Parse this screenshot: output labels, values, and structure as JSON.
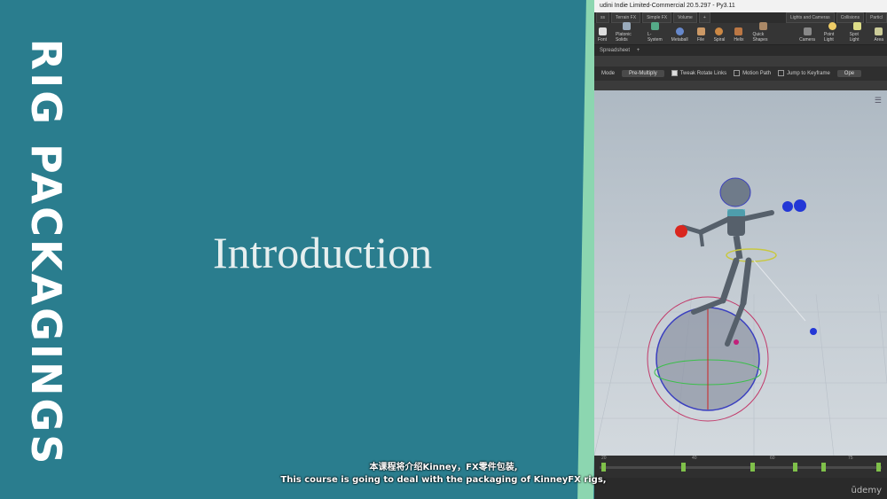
{
  "slide": {
    "vertical_title": "RIG PACKAGINGS",
    "heading": "Introduction",
    "bg_color": "#2a7d8e",
    "divider_color": "#8cd6b0"
  },
  "app": {
    "title": "udini Indie Limited-Commercial 20.5.297 - Py3.11",
    "shelf_tabs": [
      "ss",
      "Terrain FX",
      "Simple FX",
      "Volume",
      "+"
    ],
    "shelf_tabs_right": [
      "Lights and Cameras",
      "Collisions",
      "Particl"
    ],
    "tools": [
      "Font",
      "Platonic Solids",
      "L-System",
      "Metaball",
      "File",
      "Spiral",
      "Helix",
      "Quick Shapes"
    ],
    "tools_right": [
      "Camera",
      "Point Light",
      "Spot Light",
      "Area"
    ],
    "spreadsheet_tab": "Spreadsheet",
    "toolbar": {
      "mode_label": "Mode",
      "mode_value": "Pre-Multiply",
      "tweak_rotate": "Tweak Rotate Links",
      "motion_path": "Motion Path",
      "jump_keyframe": "Jump to Keyframe",
      "open": "Ope"
    },
    "timeline_numbers": [
      "20",
      "40",
      "60",
      "75"
    ]
  },
  "subtitles": {
    "chinese": "本课程将介绍Kinney，FX零件包装,",
    "english": "This course is going to deal with the packaging of KinneyFX rigs,"
  },
  "watermark": "ūdemy"
}
